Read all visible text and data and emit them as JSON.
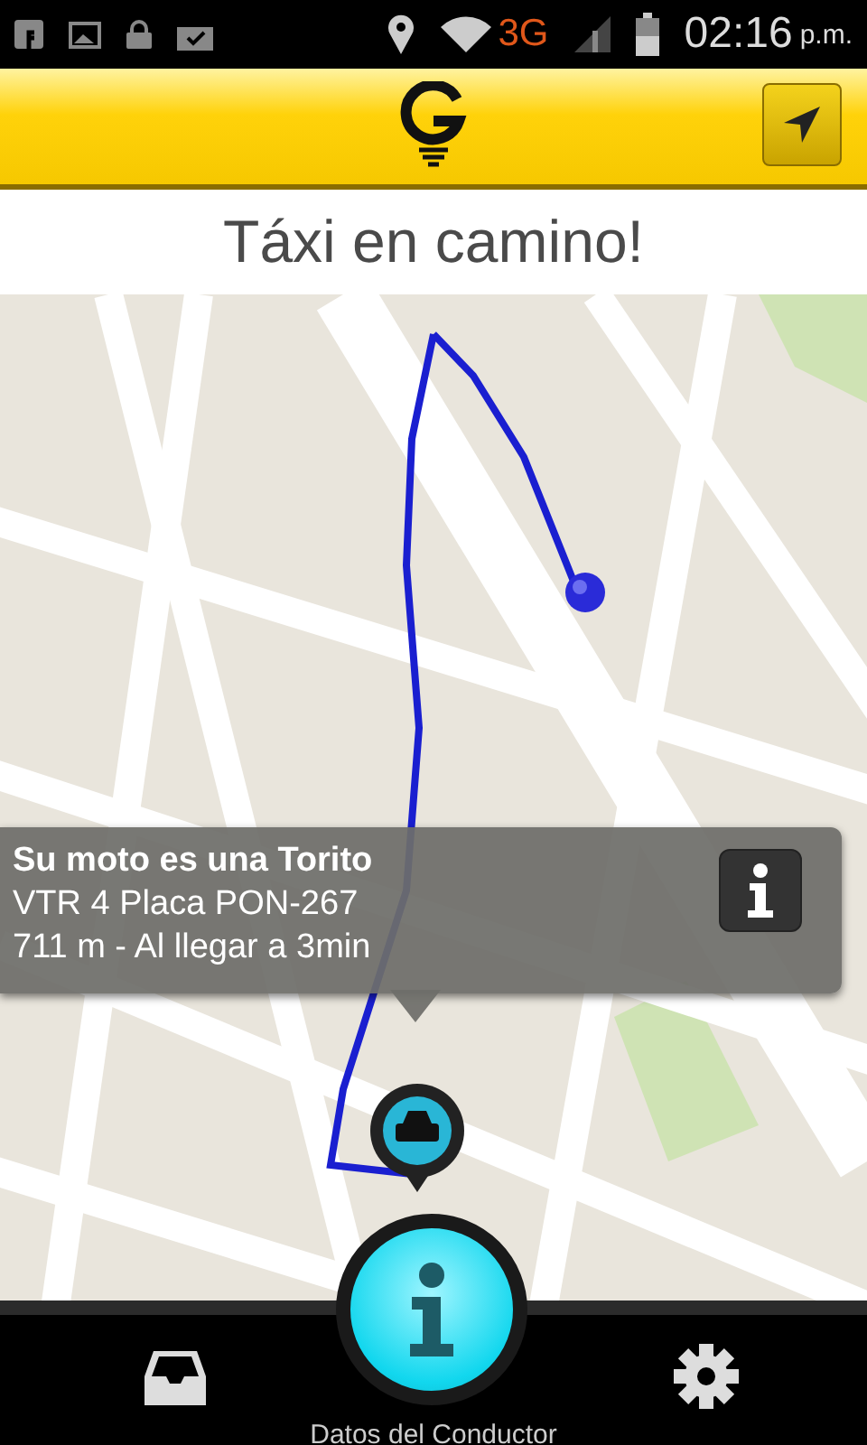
{
  "status_bar": {
    "network": "3G",
    "time": "02:16",
    "period": "p.m."
  },
  "title": "Táxi en camino!",
  "info_card": {
    "title": "Su moto es una Torito",
    "line_1": "VTR 4 Placa PON-267",
    "line_2": "711 m - Al llegar a 3min"
  },
  "bottom_nav": {
    "label": "Datos del Conductor"
  }
}
